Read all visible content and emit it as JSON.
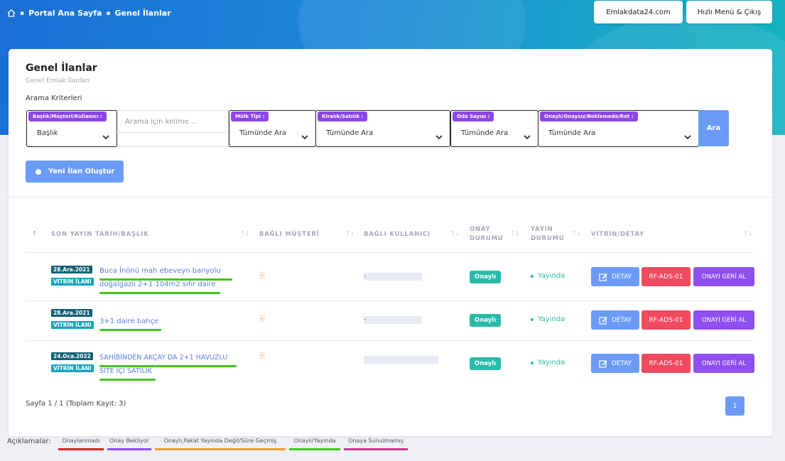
{
  "breadcrumb": {
    "home": "Portal Ana Sayfa",
    "current": "Genel İlanlar"
  },
  "header": {
    "site_button": "Emlakdata24.com",
    "menu_button": "Hızlı Menü & Çıkış"
  },
  "page": {
    "title": "Genel İlanlar",
    "subtitle": "Genel Emlak İlanları",
    "criteria_label": "Arama Kriterleri"
  },
  "filters": {
    "baslik": {
      "tag": "Başlık/Müşteri/Kullanıcı :",
      "value": "Başlık"
    },
    "search_placeholder": "Arama için kelime ...",
    "mulk_tipi": {
      "tag": "Mülk Tipi :",
      "value": "Tümünde Ara"
    },
    "kiralik_satilik": {
      "tag": "Kiralık/Satılık :",
      "value": "Tümünde Ara"
    },
    "oda_sayisi": {
      "tag": "Oda Sayısı :",
      "value": "Tümünde Ara"
    },
    "onay": {
      "tag": "Onaylı/Onaysız/Beklemede/Ret :",
      "value": "Tümünde Ara"
    },
    "ara_button": "Ara"
  },
  "new_listing_button": "Yeni İlan Oluştur",
  "table": {
    "headers": {
      "son_yayin": "SON YAYIN TARİH/BAŞLIK",
      "musteri": "BAĞLI MÜŞTERİ",
      "kullanici": "BAĞLI KULLANICI",
      "onay_1": "ONAY",
      "onay_2": "DURUMU",
      "yayin_1": "YAYIN",
      "yayin_2": "DURUMU",
      "vitrin": "VİTRİN/DETAY"
    },
    "rows": [
      {
        "date": "28.Ara.2021",
        "vitrin": "VİTRİN İLANI",
        "title_1": "Buca İnönü mah ebeveyn banyolu",
        "title_2": "doğalgazlı 2+1 104m2 sıfır daire",
        "musteri": "-",
        "kullanici": "-",
        "onay": "Onaylı",
        "yayin": "Yayında",
        "detay": "DETAY",
        "ref": "RF-ADS-01",
        "geri_al": "ONAYI GERİ AL"
      },
      {
        "date": "28.Ara.2021",
        "vitrin": "VİTRİN İLANI",
        "title_1": "3+1 daire bahçe",
        "title_2": "",
        "musteri": "-",
        "kullanici": "-",
        "onay": "Onaylı",
        "yayin": "Yayında",
        "detay": "DETAY",
        "ref": "RF-ADS-01",
        "geri_al": "ONAYI GERİ AL"
      },
      {
        "date": "24.Oca.2022",
        "vitrin": "VİTRİN İLANI",
        "title_1": "SAHİBİNDEN AKÇAY DA 2+1 HAVUZLU",
        "title_2": "SİTE İÇİ SATILIK",
        "musteri": "-",
        "kullanici": "",
        "onay": "Onaylı",
        "yayin": "Yayında",
        "detay": "DETAY",
        "ref": "RF-ADS-01",
        "geri_al": "ONAYI GERİ AL"
      }
    ]
  },
  "pagination": {
    "summary": "Sayfa 1 / 1 (Toplam Kayıt: 3)",
    "current_page": "1"
  },
  "legend": {
    "label": "Açıklamalar:",
    "items": [
      {
        "text": "Onaylanmadı",
        "color": "#e02020"
      },
      {
        "text": "Onay Bekliyor",
        "color": "#8f4ef0"
      },
      {
        "text": "Onaylı,Fakat Yayında Değil/Süre Geçmiş",
        "color": "#e8a030"
      },
      {
        "text": "Onaylı/Yayında",
        "color": "#44c51e"
      },
      {
        "text": "Onaya Sunulmamış",
        "color": "#d4329a"
      }
    ]
  },
  "colors": {
    "accent": "#6b9bf7",
    "purple": "#8f4ef0",
    "red": "#ef4a5e",
    "teal": "#27bba8",
    "green": "#44c51e"
  }
}
